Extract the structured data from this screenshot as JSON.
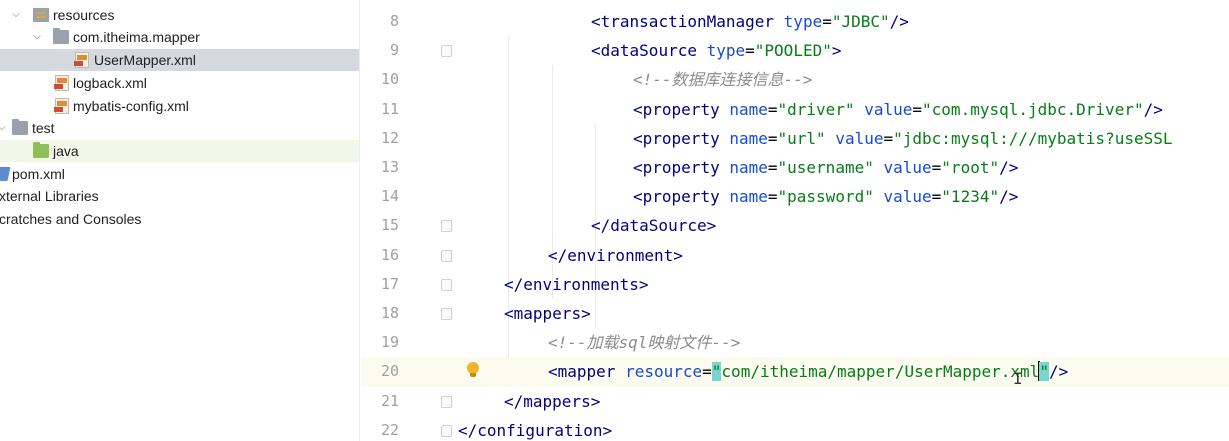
{
  "project_tree": {
    "items": [
      {
        "label": "resources",
        "icon": "resources-folder-icon",
        "expanded": true
      },
      {
        "label": "com.itheima.mapper",
        "icon": "package-folder-icon",
        "expanded": true
      },
      {
        "label": "UserMapper.xml",
        "icon": "xml-file-icon",
        "selected": true
      },
      {
        "label": "logback.xml",
        "icon": "xml-file-icon"
      },
      {
        "label": "mybatis-config.xml",
        "icon": "xml-file-icon"
      },
      {
        "label": "test",
        "icon": "folder-icon",
        "expanded": true
      },
      {
        "label": "java",
        "icon": "source-folder-icon"
      },
      {
        "label": "pom.xml",
        "icon": "maven-file-icon"
      },
      {
        "label": "xternal Libraries",
        "icon": ""
      },
      {
        "label": "cratches and Consoles",
        "icon": ""
      }
    ]
  },
  "editor": {
    "current_line": "20",
    "lines": [
      {
        "num": "8",
        "parts": [
          [
            "tag",
            "<"
          ],
          [
            "tag",
            "transactionManager"
          ],
          [
            "plain",
            " "
          ],
          [
            "attr",
            "type"
          ],
          [
            "plain",
            "="
          ],
          [
            "str",
            "\"JDBC\""
          ],
          [
            "tag",
            "/>"
          ]
        ]
      },
      {
        "num": "9",
        "parts": [
          [
            "tag",
            "<"
          ],
          [
            "tag",
            "dataSource"
          ],
          [
            "plain",
            " "
          ],
          [
            "attr",
            "type"
          ],
          [
            "plain",
            "="
          ],
          [
            "str",
            "\"POOLED\""
          ],
          [
            "tag",
            ">"
          ]
        ]
      },
      {
        "num": "10",
        "parts": [
          [
            "cmt",
            "<!--数据库连接信息-->"
          ]
        ]
      },
      {
        "num": "11",
        "parts": [
          [
            "tag",
            "<"
          ],
          [
            "tag",
            "property"
          ],
          [
            "plain",
            " "
          ],
          [
            "attr",
            "name"
          ],
          [
            "plain",
            "="
          ],
          [
            "str",
            "\"driver\""
          ],
          [
            "plain",
            " "
          ],
          [
            "attr",
            "value"
          ],
          [
            "plain",
            "="
          ],
          [
            "str",
            "\"com.mysql.jdbc.Driver\""
          ],
          [
            "tag",
            "/>"
          ]
        ]
      },
      {
        "num": "12",
        "parts": [
          [
            "tag",
            "<"
          ],
          [
            "tag",
            "property"
          ],
          [
            "plain",
            " "
          ],
          [
            "attr",
            "name"
          ],
          [
            "plain",
            "="
          ],
          [
            "str",
            "\"url\""
          ],
          [
            "plain",
            " "
          ],
          [
            "attr",
            "value"
          ],
          [
            "plain",
            "="
          ],
          [
            "str",
            "\"jdbc:mysql:///mybatis?useSSL"
          ]
        ]
      },
      {
        "num": "13",
        "parts": [
          [
            "tag",
            "<"
          ],
          [
            "tag",
            "property"
          ],
          [
            "plain",
            " "
          ],
          [
            "attr",
            "name"
          ],
          [
            "plain",
            "="
          ],
          [
            "str",
            "\"username\""
          ],
          [
            "plain",
            " "
          ],
          [
            "attr",
            "value"
          ],
          [
            "plain",
            "="
          ],
          [
            "str",
            "\"root\""
          ],
          [
            "tag",
            "/>"
          ]
        ]
      },
      {
        "num": "14",
        "parts": [
          [
            "tag",
            "<"
          ],
          [
            "tag",
            "property"
          ],
          [
            "plain",
            " "
          ],
          [
            "attr",
            "name"
          ],
          [
            "plain",
            "="
          ],
          [
            "str",
            "\"password\""
          ],
          [
            "plain",
            " "
          ],
          [
            "attr",
            "value"
          ],
          [
            "plain",
            "="
          ],
          [
            "str",
            "\"1234\""
          ],
          [
            "tag",
            "/>"
          ]
        ]
      },
      {
        "num": "15",
        "parts": [
          [
            "tag",
            "</"
          ],
          [
            "tag",
            "dataSource"
          ],
          [
            "tag",
            ">"
          ]
        ]
      },
      {
        "num": "16",
        "parts": [
          [
            "tag",
            "</"
          ],
          [
            "tag",
            "environment"
          ],
          [
            "tag",
            ">"
          ]
        ]
      },
      {
        "num": "17",
        "parts": [
          [
            "tag",
            "</"
          ],
          [
            "tag",
            "environments"
          ],
          [
            "tag",
            ">"
          ]
        ]
      },
      {
        "num": "18",
        "parts": [
          [
            "tag",
            "<"
          ],
          [
            "tag",
            "mappers"
          ],
          [
            "tag",
            ">"
          ]
        ]
      },
      {
        "num": "19",
        "parts": [
          [
            "cmt",
            "<!--加载sql映射文件-->"
          ]
        ]
      },
      {
        "num": "20",
        "parts": [
          [
            "tag",
            "<"
          ],
          [
            "tag",
            "mapper"
          ],
          [
            "plain",
            " "
          ],
          [
            "attr",
            "resource"
          ],
          [
            "plain",
            "="
          ],
          [
            "strq",
            "\""
          ],
          [
            "str",
            "com/itheima/mapper/UserMapper.xml"
          ],
          [
            "caret",
            ""
          ],
          [
            "strq",
            "\""
          ],
          [
            "tag",
            "/>"
          ]
        ]
      },
      {
        "num": "21",
        "parts": [
          [
            "tag",
            "</"
          ],
          [
            "tag",
            "mappers"
          ],
          [
            "tag",
            ">"
          ]
        ]
      },
      {
        "num": "22",
        "parts": [
          [
            "tag",
            "</"
          ],
          [
            "tag",
            "configuration"
          ],
          [
            "tag",
            ">"
          ]
        ]
      }
    ]
  },
  "colors": {
    "tag": "#000080",
    "attribute": "#174ad4",
    "string": "#067d17",
    "comment": "#8c8c8c",
    "selection": "#d5d9df",
    "bracket_match": "#7ad5cf"
  }
}
